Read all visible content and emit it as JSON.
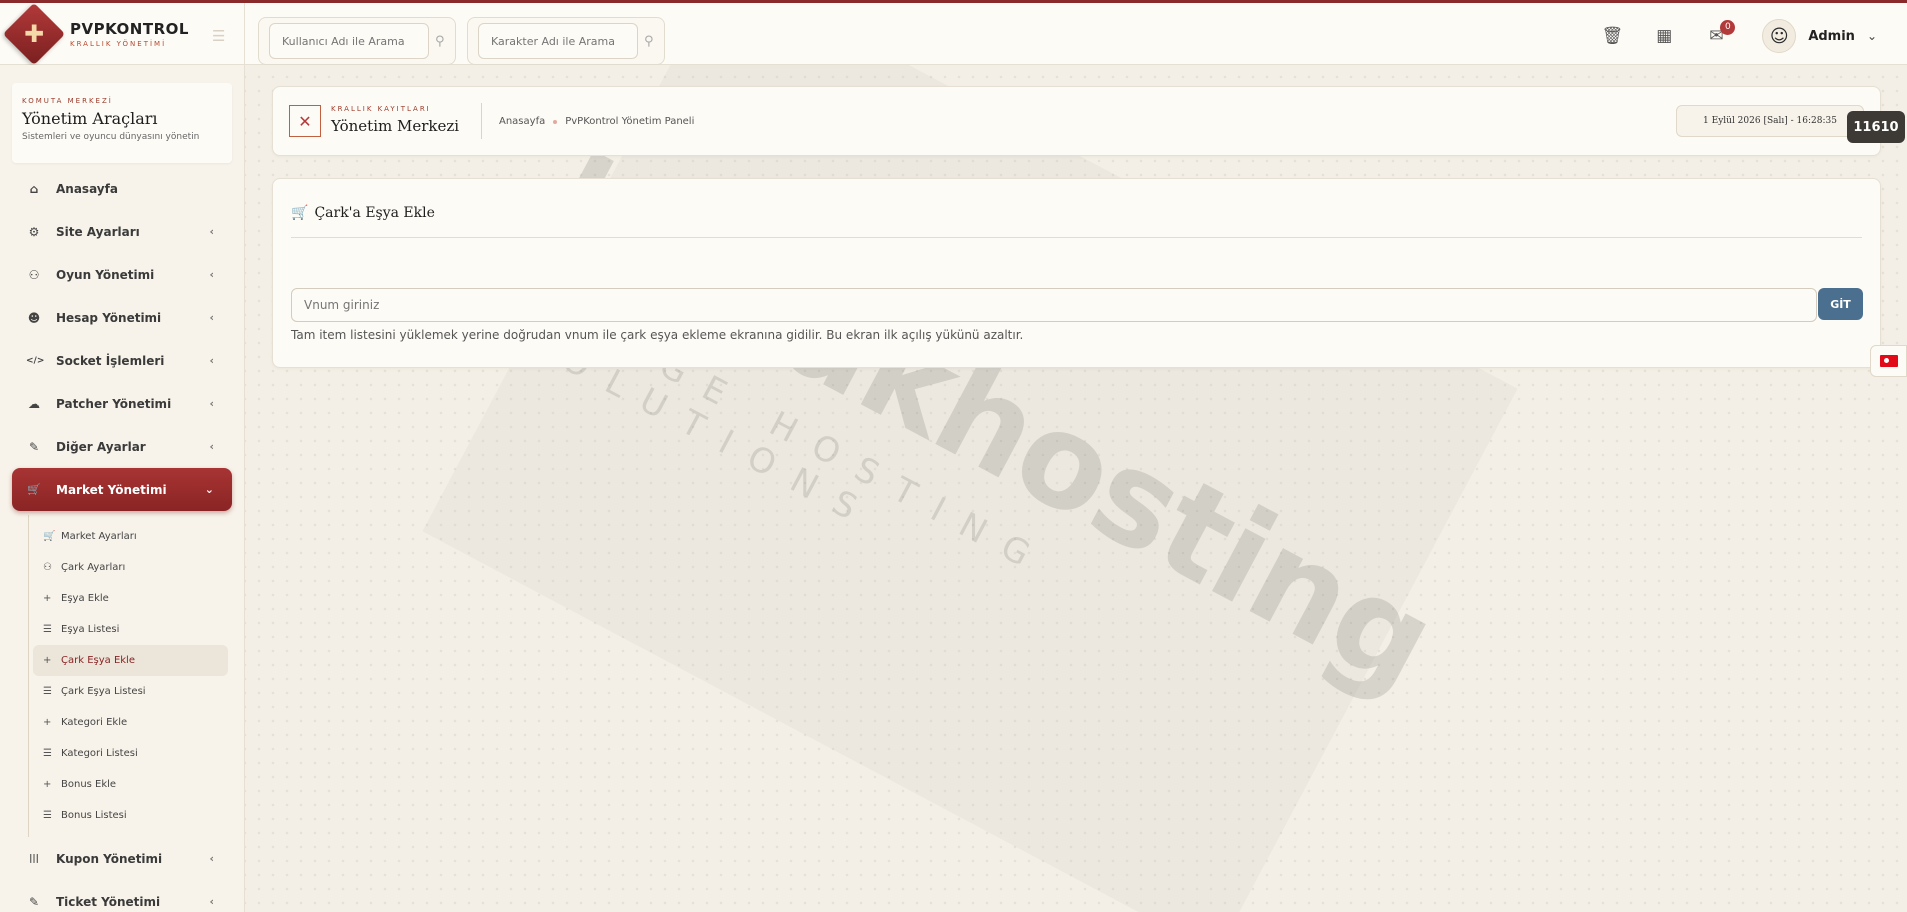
{
  "brand": {
    "name": "PVPKONTROL",
    "subtitle": "KRALLIK YÖNETİMİ",
    "logo_glyph": "✚"
  },
  "topbar": {
    "user_search_placeholder": "Kullanıcı Adı ile Arama",
    "char_search_placeholder": "Karakter Adı ile Arama",
    "notification_count": "0",
    "admin_name": "Admin",
    "icons": [
      "trash-icon",
      "calendar-icon",
      "inbox-icon"
    ]
  },
  "sidebar": {
    "kicker": "KOMUTA MERKEZİ",
    "title": "Yönetim Araçları",
    "subtitle": "Sistemleri ve oyuncu dünyasını yönetin",
    "items": [
      {
        "label": "Anasayfa",
        "icon": "⌂"
      },
      {
        "label": "Site Ayarları",
        "icon": "⚙"
      },
      {
        "label": "Oyun Yönetimi",
        "icon": "⚇"
      },
      {
        "label": "Hesap Yönetimi",
        "icon": "☻"
      },
      {
        "label": "Socket İşlemleri",
        "icon": "</>"
      },
      {
        "label": "Patcher Yönetimi",
        "icon": "☁"
      },
      {
        "label": "Diğer Ayarlar",
        "icon": "✎"
      },
      {
        "label": "Market Yönetimi",
        "icon": "🛒"
      }
    ],
    "market_sub": [
      {
        "label": "Market Ayarları",
        "icon": "🛒"
      },
      {
        "label": "Çark Ayarları",
        "icon": "⚇"
      },
      {
        "label": "Eşya Ekle",
        "icon": "+"
      },
      {
        "label": "Eşya Listesi",
        "icon": "☰"
      },
      {
        "label": "Çark Eşya Ekle",
        "icon": "+"
      },
      {
        "label": "Çark Eşya Listesi",
        "icon": "☰"
      },
      {
        "label": "Kategori Ekle",
        "icon": "+"
      },
      {
        "label": "Kategori Listesi",
        "icon": "☰"
      },
      {
        "label": "Bonus Ekle",
        "icon": "+"
      },
      {
        "label": "Bonus Listesi",
        "icon": "☰"
      }
    ],
    "after": [
      {
        "label": "Kupon Yönetimi",
        "icon": "|||"
      },
      {
        "label": "Ticket Yönetimi",
        "icon": "✎"
      }
    ]
  },
  "header": {
    "kicker": "KRALLIK KAYITLARI",
    "title": "Yönetim Merkezi",
    "breadcrumb": [
      "Anasayfa",
      "PvPKontrol Yönetim Paneli"
    ],
    "clock": "1 Eylül 2026 [Salı] - 16:28:35",
    "counter": "11610"
  },
  "main": {
    "title": "Çark'a Eşya Ekle",
    "input_placeholder": "Vnum giriniz",
    "button": "GİT",
    "help": "Tam item listesini yüklemek yerine doğrudan vnum ile çark eşya ekleme ekranına gidilir. Bu ekran ilk açılış yükünü azaltır."
  },
  "watermark": {
    "main": "buyukhosting",
    "sub": "LARGE HOSTING SOLUTIONS"
  },
  "colors": {
    "accent": "#8b2a2a",
    "button": "#4a6f8f",
    "background": "#f3efe6"
  }
}
